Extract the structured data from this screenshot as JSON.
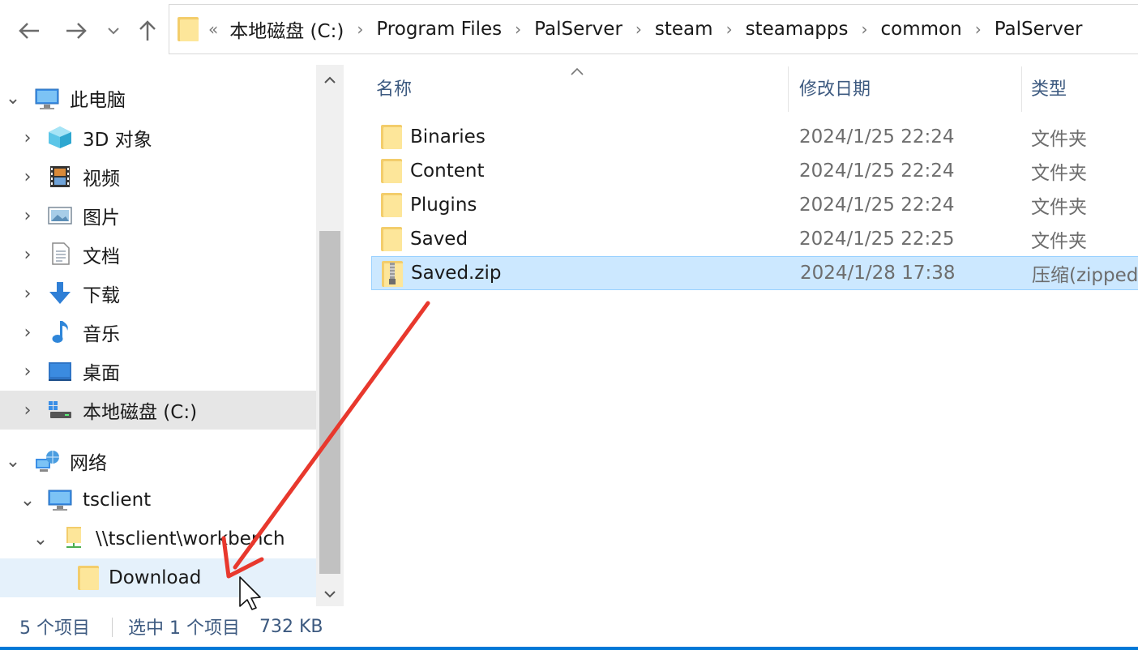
{
  "window": {
    "accent_color": "#0078d7"
  },
  "address_bar": {
    "overflow_glyph": "«",
    "crumbs": [
      "本地磁盘 (C:)",
      "Program Files",
      "PalServer",
      "steam",
      "steamapps",
      "common",
      "PalServer"
    ]
  },
  "nav_buttons": {
    "back_icon": "arrow-left-icon",
    "forward_icon": "arrow-right-icon",
    "recent_icon": "chevron-down-icon",
    "up_icon": "arrow-up-icon"
  },
  "nav_pane": {
    "items": [
      {
        "label": "此电脑",
        "icon": "computer-icon",
        "chevron": "expanded",
        "level": 0
      },
      {
        "label": "3D 对象",
        "icon": "3d-objects-icon",
        "chevron": "collapsed",
        "level": 1
      },
      {
        "label": "视频",
        "icon": "video-icon",
        "chevron": "collapsed",
        "level": 1
      },
      {
        "label": "图片",
        "icon": "picture-icon",
        "chevron": "collapsed",
        "level": 1
      },
      {
        "label": "文档",
        "icon": "document-icon",
        "chevron": "collapsed",
        "level": 1
      },
      {
        "label": "下载",
        "icon": "download-icon",
        "chevron": "collapsed",
        "level": 1
      },
      {
        "label": "音乐",
        "icon": "music-icon",
        "chevron": "collapsed",
        "level": 1
      },
      {
        "label": "桌面",
        "icon": "desktop-icon",
        "chevron": "collapsed",
        "level": 1
      },
      {
        "label": "本地磁盘 (C:)",
        "icon": "drive-icon",
        "chevron": "collapsed",
        "level": 1
      },
      {
        "label": "网络",
        "icon": "network-icon",
        "chevron": "expanded",
        "level": 0
      },
      {
        "label": "tsclient",
        "icon": "computer-icon",
        "chevron": "expanded",
        "level": 1
      },
      {
        "label": "\\\\tsclient\\workbench",
        "icon": "network-folder-icon",
        "chevron": "expanded",
        "level": 2
      },
      {
        "label": "Download",
        "icon": "folder-icon",
        "chevron": "none",
        "level": 3
      }
    ]
  },
  "file_list": {
    "columns": {
      "name": "名称",
      "modified": "修改日期",
      "type": "类型"
    },
    "rows": [
      {
        "name": "Binaries",
        "modified": "2024/1/25 22:24",
        "type": "文件夹",
        "icon": "folder-icon"
      },
      {
        "name": "Content",
        "modified": "2024/1/25 22:24",
        "type": "文件夹",
        "icon": "folder-icon"
      },
      {
        "name": "Plugins",
        "modified": "2024/1/25 22:24",
        "type": "文件夹",
        "icon": "folder-icon"
      },
      {
        "name": "Saved",
        "modified": "2024/1/25 22:25",
        "type": "文件夹",
        "icon": "folder-icon"
      },
      {
        "name": "Saved.zip",
        "modified": "2024/1/28 17:38",
        "type": "压缩(zipped",
        "icon": "zip-folder-icon",
        "selected": true
      }
    ]
  },
  "status_bar": {
    "item_count": "5 个项目",
    "selection": "选中 1 个项目",
    "size": "732 KB"
  },
  "annotation": {
    "arrow_color": "#e8382d"
  }
}
